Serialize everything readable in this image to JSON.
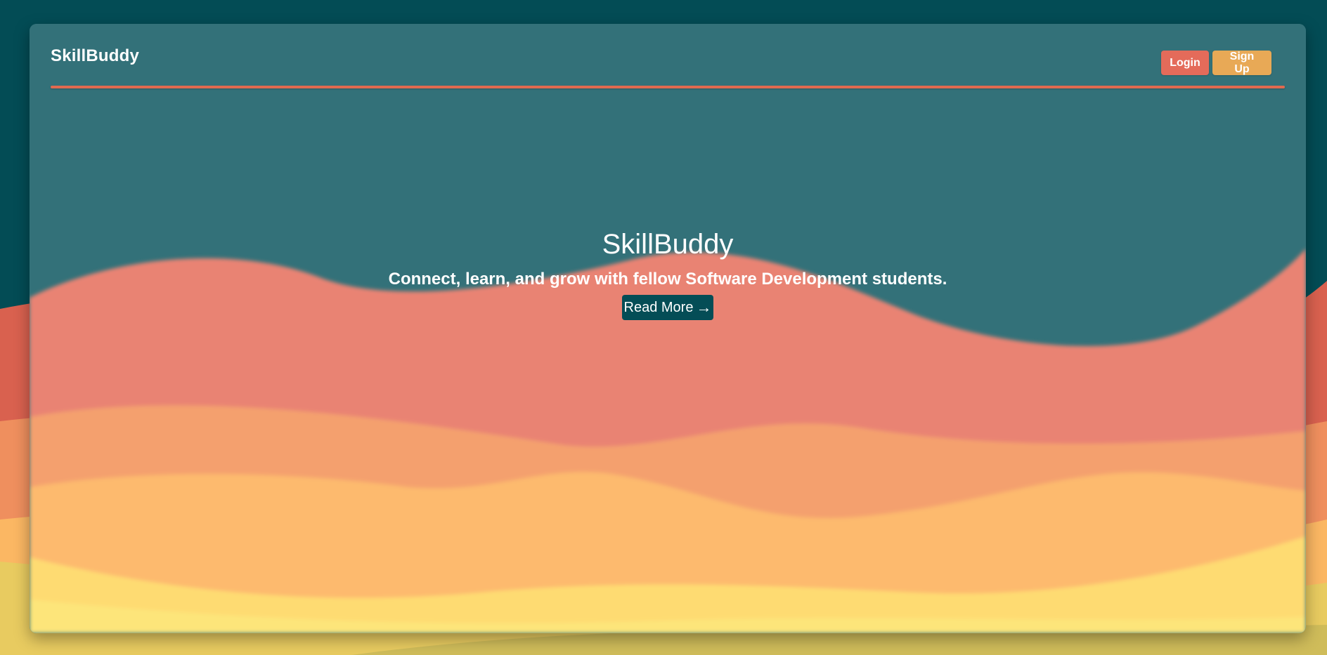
{
  "app": {
    "brand": "SkillBuddy"
  },
  "nav": {
    "login_label": "Login",
    "signup_label": "Sign Up"
  },
  "hero": {
    "title": "SkillBuddy",
    "subtitle": "Connect, learn, and grow with fellow Software Development students.",
    "cta_label": "Read More",
    "cta_icon": "→"
  },
  "colors": {
    "page_background": "#034c55",
    "card_background": "#337179",
    "accent_red": "#e46b5a",
    "accent_orange": "#e8a956",
    "divider": "#e06a50",
    "wave_salmon": "#e98373",
    "wave_peach": "#f4a06e",
    "wave_orange": "#fdba6e",
    "wave_yellow": "#fedb72"
  }
}
